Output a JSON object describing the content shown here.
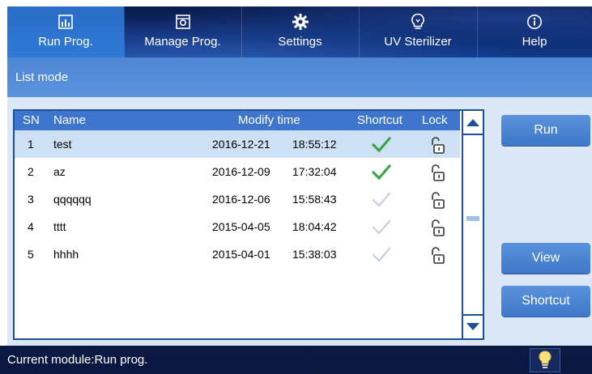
{
  "nav": {
    "tabs": [
      {
        "label": "Run Prog.",
        "icon": "run-program-icon"
      },
      {
        "label": "Manage Prog.",
        "icon": "manage-program-icon"
      },
      {
        "label": "Settings",
        "icon": "gear-icon"
      },
      {
        "label": "UV Sterilizer",
        "icon": "uv-bulb-icon"
      },
      {
        "label": "Help",
        "icon": "info-icon"
      }
    ]
  },
  "mode": "List mode",
  "list": {
    "headers": {
      "sn": "SN",
      "name": "Name",
      "modify_time": "Modify time",
      "shortcut": "Shortcut",
      "lock": "Lock"
    },
    "rows": [
      {
        "sn": "1",
        "name": "test",
        "date": "2016-12-21",
        "time": "18:55:12",
        "shortcut": true
      },
      {
        "sn": "2",
        "name": "az",
        "date": "2016-12-09",
        "time": "17:32:04",
        "shortcut": true
      },
      {
        "sn": "3",
        "name": "qqqqqq",
        "date": "2016-12-06",
        "time": "15:58:43",
        "shortcut": false
      },
      {
        "sn": "4",
        "name": "tttt",
        "date": "2015-04-05",
        "time": "18:04:42",
        "shortcut": false
      },
      {
        "sn": "5",
        "name": "hhhh",
        "date": "2015-04-01",
        "time": "15:38:03",
        "shortcut": false
      }
    ]
  },
  "buttons": {
    "run": "Run",
    "view": "View",
    "shortcut": "Shortcut"
  },
  "status": "Current module:Run prog.",
  "colors": {
    "accent": "#3d76cc",
    "nav_dark": "#0c2a6e",
    "check_on": "#3aa54a",
    "check_off": "#b8c4d2"
  }
}
